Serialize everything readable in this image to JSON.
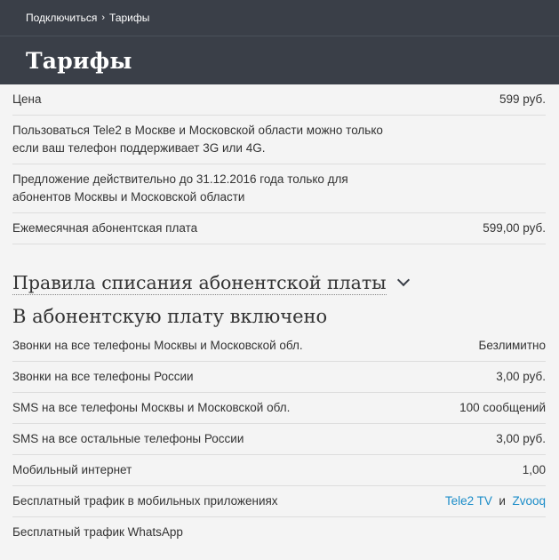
{
  "breadcrumbs": {
    "items": [
      "Подключиться",
      "Тарифы"
    ],
    "separator": "›"
  },
  "page_title": "Тарифы",
  "info_rows": [
    {
      "label": "Цена",
      "value": "599 руб."
    },
    {
      "label": "Пользоваться Tele2 в Москве и Московской области можно только если ваш телефон поддерживает 3G или 4G.",
      "value": ""
    },
    {
      "label": "Предложение действительно до 31.12.2016 года только для абонентов Москвы и Московской области",
      "value": ""
    },
    {
      "label": "Ежемесячная абонентская плата",
      "value": "599,00 руб."
    }
  ],
  "rules_header": "Правила списания абонентской платы",
  "included_section": {
    "title": "В абонентскую плату включено",
    "rows": [
      {
        "label": "Звонки на все телефоны Москвы и Московской обл.",
        "value": "Безлимитно"
      },
      {
        "label": "Звонки на все телефоны России",
        "value": "3,00 руб."
      },
      {
        "label": "SMS на все телефоны Москвы и Московской обл.",
        "value": "100 сообщений"
      },
      {
        "label": "SMS на все остальные телефоны России",
        "value": "3,00 руб."
      },
      {
        "label": "Мобильный интернет",
        "value": "1,00"
      },
      {
        "label": "Бесплатный трафик в мобильных приложениях",
        "links": [
          "Tele2 TV",
          "Zvooq"
        ],
        "conjunction": "и"
      },
      {
        "label": "Бесплатный трафик WhatsApp",
        "value": ""
      }
    ]
  },
  "colors": {
    "header_bg": "#3a3f48",
    "link": "#1a8cc8",
    "page_bg": "#f4f4f4"
  }
}
